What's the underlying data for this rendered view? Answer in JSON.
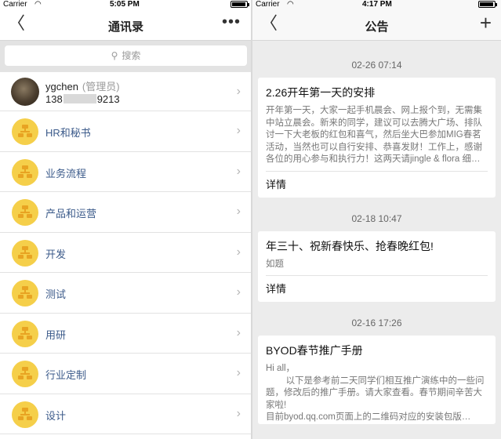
{
  "left": {
    "status": {
      "carrier": "Carrier",
      "time": "5:05 PM"
    },
    "nav": {
      "back": "〈",
      "title": "通讯录",
      "more": "•••"
    },
    "search": {
      "placeholder": "搜索"
    },
    "profile": {
      "name": "ygchen",
      "role": "(管理员)",
      "phone_prefix": "138",
      "phone_suffix": "9213"
    },
    "items": [
      {
        "label": "HR和秘书"
      },
      {
        "label": "业务流程"
      },
      {
        "label": "产品和运营"
      },
      {
        "label": "开发"
      },
      {
        "label": "测试"
      },
      {
        "label": "用研"
      },
      {
        "label": "行业定制"
      },
      {
        "label": "设计"
      }
    ]
  },
  "right": {
    "status": {
      "carrier": "Carrier",
      "time": "4:17 PM"
    },
    "nav": {
      "back": "〈",
      "title": "公告",
      "add": "+"
    },
    "announcements": [
      {
        "date": "02-26 07:14",
        "title": "2.26开年第一天的安排",
        "body": "开年第一天，大家一起手机晨会、网上报个到，无需集中站立晨会。新来的同学，建议可以去腾大广场、排队讨一下大老板的红包和喜气，然后坐大巴参加MIG春茗活动，当然也可以自行安排、恭喜发财！工作上，感谢各位的用心参与和执行力！这两天请jingle & flora 细…",
        "footer": "详情"
      },
      {
        "date": "02-18 10:47",
        "title": "年三十、祝新春快乐、抢春晚红包!",
        "body": "如题",
        "footer": "详情"
      },
      {
        "date": "02-16 17:26",
        "title": "BYOD春节推广手册",
        "body": "Hi all，\n        以下是参考前二天同学们相互推广演练中的一些问题，修改后的推广手册。请大家查看。春节期间辛苦大家啦!\n目前byod.qq.com页面上的二维码对应的安装包版…",
        "footer": ""
      }
    ]
  },
  "colors": {
    "folder_bg": "#f5cf4a",
    "folder_mark": "#e8a322",
    "link_text": "#3b5a8a",
    "right_bg": "#ececec"
  }
}
